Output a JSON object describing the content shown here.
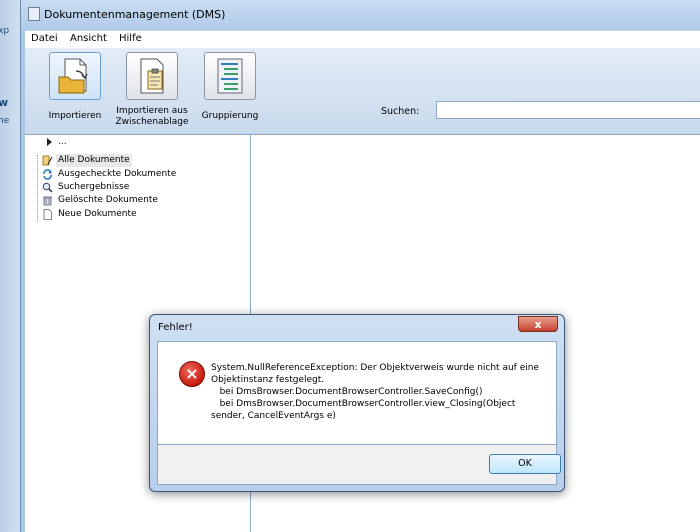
{
  "background_window": {
    "fragments": [
      "xp",
      "w",
      "ne"
    ]
  },
  "window": {
    "title": "Dokumentenmanagement (DMS)"
  },
  "menu": [
    "Datei",
    "Ansicht",
    "Hilfe"
  ],
  "toolbar": {
    "buttons": [
      {
        "label": "Importieren",
        "icon": "import-folder-icon"
      },
      {
        "label_line1": "Importieren aus",
        "label_line2": "Zwischenablage",
        "icon": "clipboard-icon"
      },
      {
        "label": "Gruppierung",
        "icon": "grouping-list-icon"
      }
    ],
    "search_label": "Suchen:",
    "search_value": ""
  },
  "tree": {
    "root": "...",
    "items": [
      {
        "label": "Alle Dokumente",
        "icon": "documents-pen-icon",
        "selected": true
      },
      {
        "label": "Ausgecheckte Dokumente",
        "icon": "checkout-arrows-icon"
      },
      {
        "label": "Suchergebnisse",
        "icon": "magnifier-icon"
      },
      {
        "label": "Gelöschte Dokumente",
        "icon": "recycle-bin-icon"
      },
      {
        "label": "Neue Dokumente",
        "icon": "new-document-icon"
      }
    ]
  },
  "dialog": {
    "title": "Fehler!",
    "close_symbol": "x",
    "icon": "error-icon",
    "message_lines": [
      "System.NullReferenceException: Der Objektverweis wurde nicht auf eine",
      "Objektinstanz festgelegt.",
      "   bei DmsBrowser.DocumentBrowserController.SaveConfig()",
      "   bei DmsBrowser.DocumentBrowserController.view_Closing(Object",
      "sender, CancelEventArgs e)"
    ],
    "ok_label": "OK"
  },
  "colors": {
    "chrome": "#a9c6e6",
    "dialog_ok_border": "#3c7fb1",
    "close_red": "#c6412e",
    "error_red": "#c81c12"
  }
}
